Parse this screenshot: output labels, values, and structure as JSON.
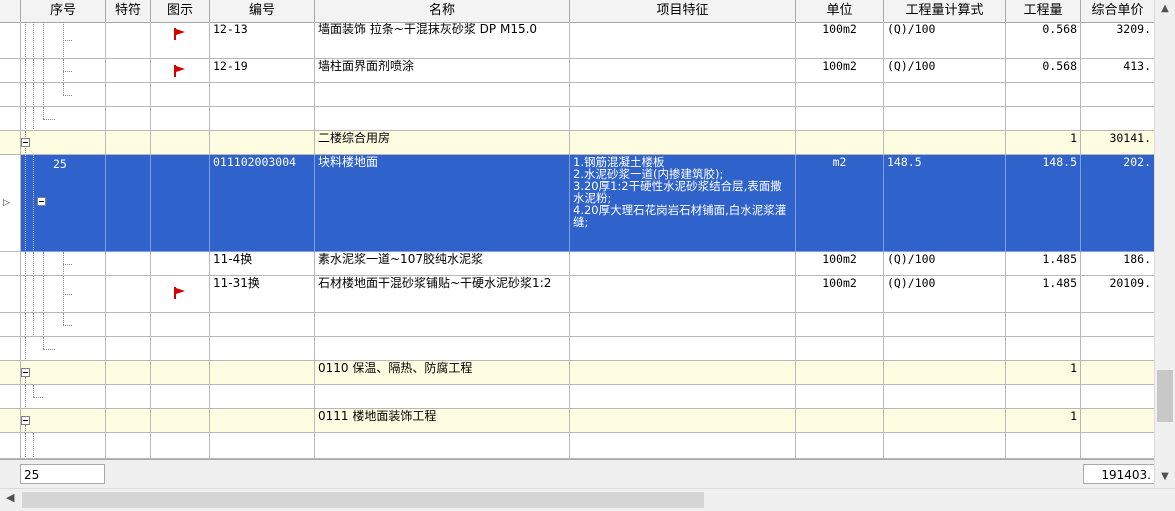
{
  "columns": [
    "序号",
    "特符",
    "图示",
    "编号",
    "名称",
    "项目特征",
    "单位",
    "工程量计算式",
    "工程量",
    "综合单价"
  ],
  "rows": [
    {
      "code": "12-13",
      "name": "墙面装饰 拉条~干混抹灰砂浆 DP M15.0",
      "unit": "100m2",
      "formula": "(Q)/100",
      "qty": "0.568",
      "price": "3209."
    },
    {
      "code": "12-19",
      "name": "墙柱面界面剂喷涂",
      "unit": "100m2",
      "formula": "(Q)/100",
      "qty": "0.568",
      "price": "413."
    },
    {
      "name": "二楼综合用房",
      "qty": "1",
      "price": "30141."
    },
    {
      "seq": "25",
      "code": "011102003004",
      "name": "块料楼地面",
      "feature": "1.钢筋混凝土楼板\n2.水泥砂浆一道(内掺建筑胶);\n3.20厚1:2干硬性水泥砂浆结合层,表面撒水泥粉;\n4.20厚大理石花岗岩石材铺面,白水泥浆灌缝;",
      "unit": "m2",
      "formula": "148.5",
      "qty": "148.5",
      "price": "202."
    },
    {
      "code": "11-4换",
      "name": "素水泥浆一道~107胶纯水泥浆",
      "unit": "100m2",
      "formula": "(Q)/100",
      "qty": "1.485",
      "price": "186."
    },
    {
      "code": "11-31换",
      "name": "石材楼地面干混砂浆铺贴~干硬水泥砂浆1:2",
      "unit": "100m2",
      "formula": "(Q)/100",
      "qty": "1.485",
      "price": "20109."
    },
    {
      "name": "0110 保温、隔热、防腐工程",
      "qty": "1"
    },
    {
      "name": "0111 楼地面装饰工程",
      "qty": "1"
    }
  ],
  "footer": {
    "left_value": "25",
    "right_value": "191403."
  },
  "colors": {
    "selected": "#2f62cb",
    "group": "#fffde1",
    "flag": "#d40000"
  },
  "icons": {
    "flag": "red-flag-icon",
    "expander": "collapse-box-icon"
  }
}
